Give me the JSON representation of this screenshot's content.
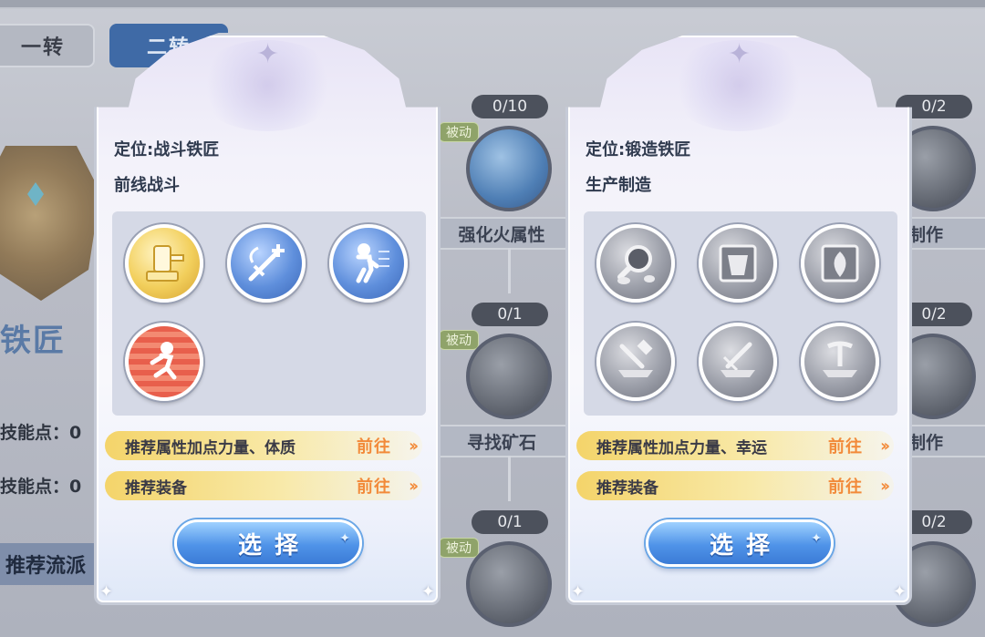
{
  "background": {
    "tabs": [
      {
        "label": "一转"
      },
      {
        "label": "二转"
      }
    ],
    "class_title": "铁匠",
    "stats": [
      {
        "label": "技能点：0"
      },
      {
        "label": "技能点：0"
      }
    ],
    "route_button": "推荐流派",
    "nodes": [
      {
        "count": "0/10",
        "passive": "被动",
        "label": "强化火属性"
      },
      {
        "count": "0/1",
        "passive": "被动",
        "label": "寻找矿石"
      },
      {
        "count": "0/1",
        "passive": "被动",
        "label": ""
      }
    ],
    "right_nodes": [
      {
        "count": "0/2",
        "label": "制作"
      },
      {
        "count": "0/2",
        "label": "制作"
      },
      {
        "count": "0/2"
      }
    ]
  },
  "cards": [
    {
      "role": "定位:战斗铁匠",
      "subtitle": "前线战斗",
      "skills": [
        {
          "icon": "hammer-block-icon",
          "color": "gold"
        },
        {
          "icon": "sword-plus-icon",
          "color": "blue"
        },
        {
          "icon": "running-figure-icon",
          "color": "blue"
        },
        {
          "icon": "sprinting-figure-icon",
          "color": "red"
        }
      ],
      "recommend_attr": "推荐属性加点力量、体质",
      "recommend_equip": "推荐装备",
      "go_label": "前往",
      "select_label": "选择"
    },
    {
      "role": "定位:锻造铁匠",
      "subtitle": "生产制造",
      "skills": [
        {
          "icon": "magnifier-ore-icon",
          "color": "grey"
        },
        {
          "icon": "armor-crate-icon",
          "color": "grey"
        },
        {
          "icon": "leaf-crate-icon",
          "color": "grey"
        },
        {
          "icon": "hammer-anvil-icon",
          "color": "grey"
        },
        {
          "icon": "sword-anvil-icon",
          "color": "grey"
        },
        {
          "icon": "pick-anvil-icon",
          "color": "grey"
        }
      ],
      "recommend_attr": "推荐属性加点力量、幸运",
      "recommend_equip": "推荐装备",
      "go_label": "前往",
      "select_label": "选择"
    }
  ],
  "colors": {
    "accent_blue": "#4f93e8",
    "go_orange": "#f28a3a",
    "recommend_yellow": "#f4d46a"
  }
}
